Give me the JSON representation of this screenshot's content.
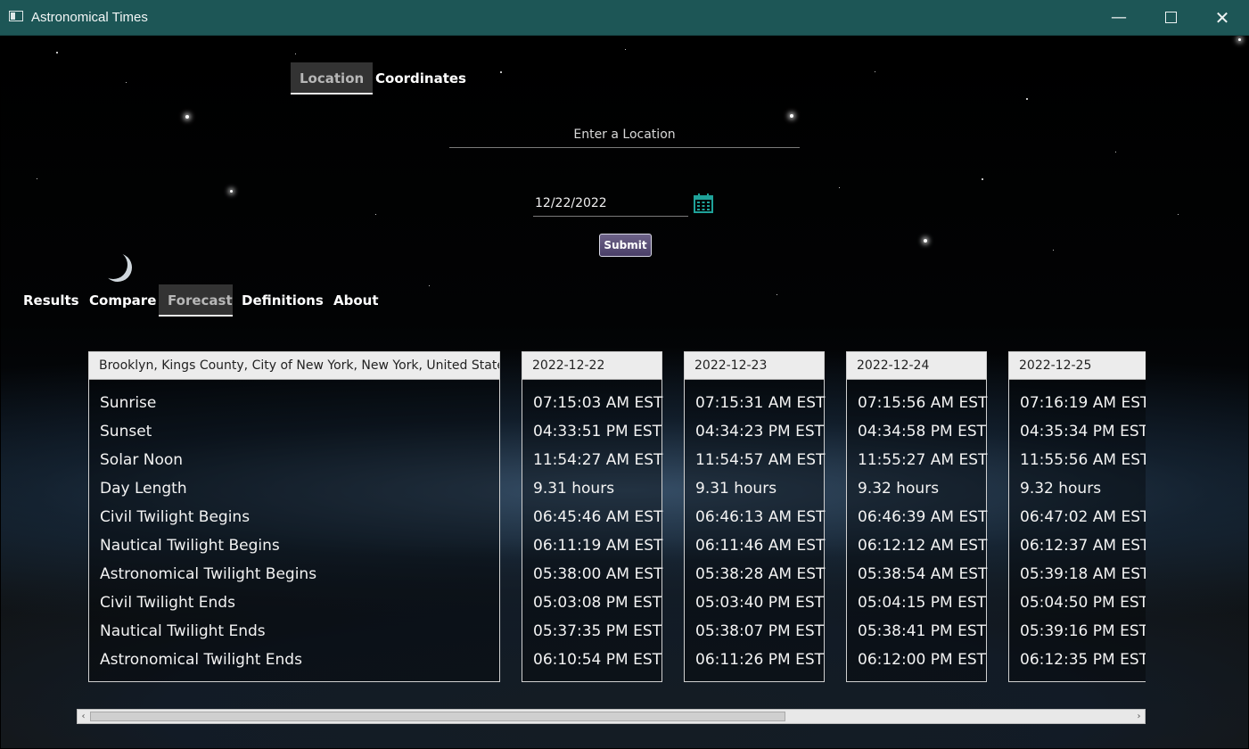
{
  "window": {
    "title": "Astronomical Times",
    "minimize_glyph": "—",
    "close_glyph": "✕"
  },
  "input_tabs": [
    {
      "label": "Location",
      "selected": true
    },
    {
      "label": "Coordinates",
      "selected": false
    }
  ],
  "location_input": {
    "placeholder": "Enter a Location",
    "value": ""
  },
  "date_input": {
    "value": "12/22/2022",
    "icon": "calendar-icon"
  },
  "submit_label": "Submit",
  "main_tabs": [
    {
      "label": "Results",
      "selected": false
    },
    {
      "label": "Compare",
      "selected": false
    },
    {
      "label": "Forecast",
      "selected": true
    },
    {
      "label": "Definitions",
      "selected": false
    },
    {
      "label": "About",
      "selected": false
    }
  ],
  "forecast": {
    "location": "Brooklyn, Kings County, City of New York, New York, United States",
    "labels": [
      "Sunrise",
      "Sunset",
      "Solar Noon",
      "Day Length",
      "Civil Twilight Begins",
      "Nautical Twilight Begins",
      "Astronomical Twilight Begins",
      "Civil Twilight Ends",
      "Nautical Twilight Ends",
      "Astronomical Twilight Ends"
    ],
    "days": [
      {
        "date": "2022-12-22",
        "values": [
          "07:15:03 AM EST",
          "04:33:51 PM EST",
          "11:54:27 AM EST",
          "9.31 hours",
          "06:45:46 AM EST",
          "06:11:19 AM EST",
          "05:38:00 AM EST",
          "05:03:08 PM EST",
          "05:37:35 PM EST",
          "06:10:54 PM EST"
        ]
      },
      {
        "date": "2022-12-23",
        "values": [
          "07:15:31 AM EST",
          "04:34:23 PM EST",
          "11:54:57 AM EST",
          "9.31 hours",
          "06:46:13 AM EST",
          "06:11:46 AM EST",
          "05:38:28 AM EST",
          "05:03:40 PM EST",
          "05:38:07 PM EST",
          "06:11:26 PM EST"
        ]
      },
      {
        "date": "2022-12-24",
        "values": [
          "07:15:56 AM EST",
          "04:34:58 PM EST",
          "11:55:27 AM EST",
          "9.32 hours",
          "06:46:39 AM EST",
          "06:12:12 AM EST",
          "05:38:54 AM EST",
          "05:04:15 PM EST",
          "05:38:41 PM EST",
          "06:12:00 PM EST"
        ]
      },
      {
        "date": "2022-12-25",
        "values": [
          "07:16:19 AM EST",
          "04:35:34 PM EST",
          "11:55:56 AM EST",
          "9.32 hours",
          "06:47:02 AM EST",
          "06:12:37 AM EST",
          "05:39:18 AM EST",
          "05:04:50 PM EST",
          "05:39:16 PM EST",
          "06:12:35 PM EST"
        ]
      }
    ]
  },
  "scrollbar": {
    "left_arrow": "‹",
    "right_arrow": "›"
  }
}
